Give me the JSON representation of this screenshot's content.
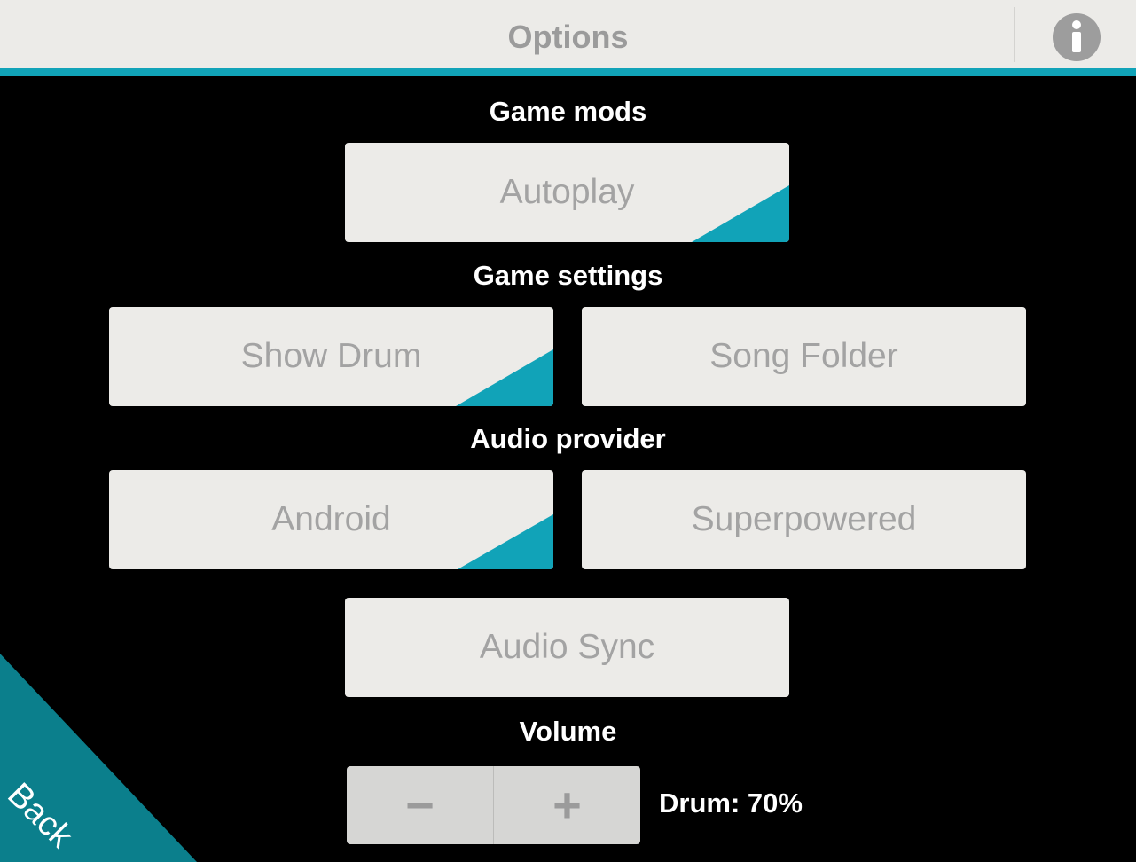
{
  "header": {
    "title": "Options",
    "info_icon": "info-icon"
  },
  "sections": {
    "game_mods": "Game mods",
    "game_settings": "Game settings",
    "audio_provider": "Audio provider",
    "volume": "Volume"
  },
  "buttons": {
    "autoplay": {
      "label": "Autoplay",
      "selected": true
    },
    "show_drum": {
      "label": "Show Drum",
      "selected": true
    },
    "song_folder": {
      "label": "Song Folder",
      "selected": false
    },
    "android": {
      "label": "Android",
      "selected": true
    },
    "superpowered": {
      "label": "Superpowered",
      "selected": false
    },
    "audio_sync": {
      "label": "Audio Sync",
      "selected": false
    }
  },
  "volume": {
    "minus_label": "−",
    "plus_label": "+",
    "drum_text": "Drum: 70%",
    "drum_percent": 70
  },
  "back": {
    "label": "Back"
  },
  "colors": {
    "accent": "#11a3b8",
    "back_bg": "#0b7f8c",
    "button_bg": "#ecebe8",
    "button_text": "#a3a3a3"
  }
}
